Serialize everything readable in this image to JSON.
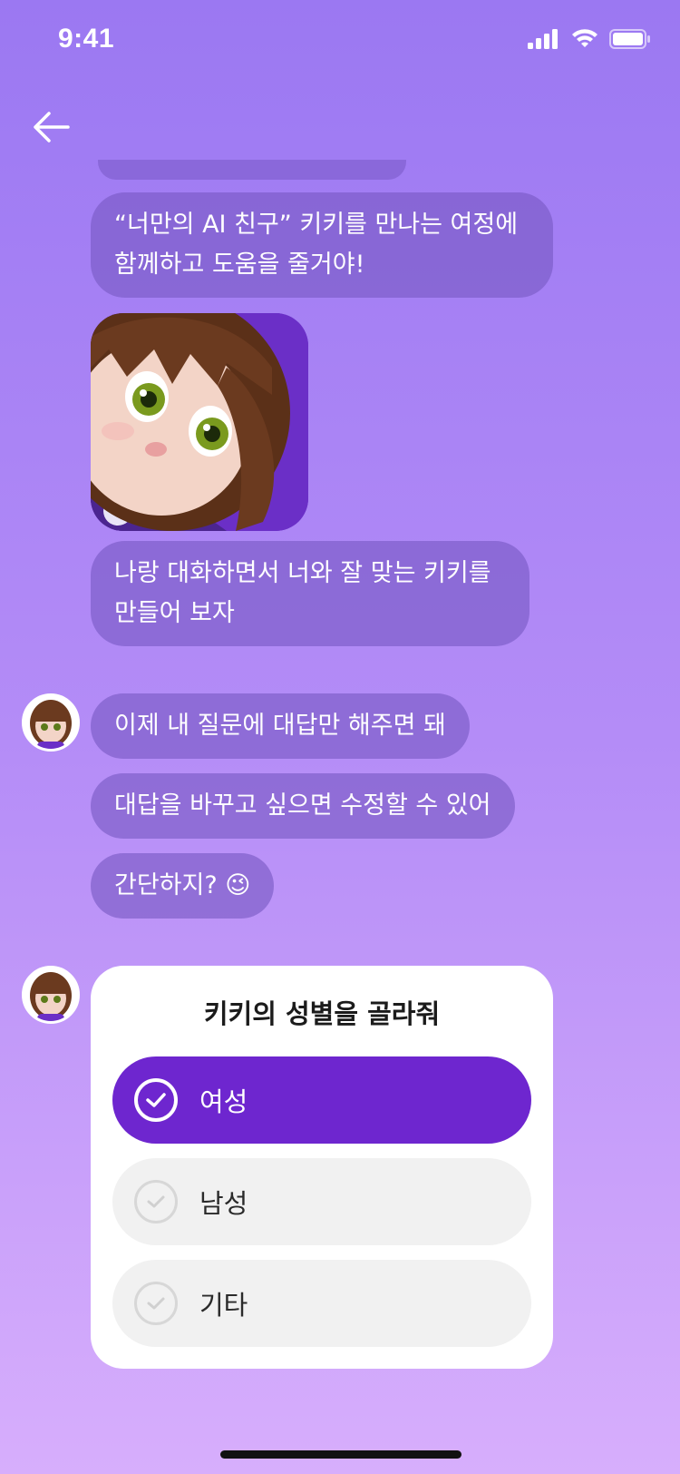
{
  "status_bar": {
    "time": "9:41"
  },
  "messages": {
    "intro": "“너만의 AI 친구” 키키를 만나는 여정에 함께하고 도움을 줄거야!",
    "talk": "나랑 대화하면서 너와 잘 맞는 키키를 만들어 보자",
    "answer_only": "이제 내 질문에 대답만 해주면 돼",
    "edit": "대답을 바꾸고 싶으면 수정할 수 있어",
    "easy": "간단하지? 😉"
  },
  "question_card": {
    "title": "키키의 성별을 골라줘",
    "options": [
      {
        "label": "여성",
        "selected": true
      },
      {
        "label": "남성",
        "selected": false
      },
      {
        "label": "기타",
        "selected": false
      }
    ]
  },
  "colors": {
    "accent": "#6e26cf",
    "bubble": "#7858c4",
    "bg_top": "#9b78f2",
    "bg_bottom": "#d7aefc"
  }
}
